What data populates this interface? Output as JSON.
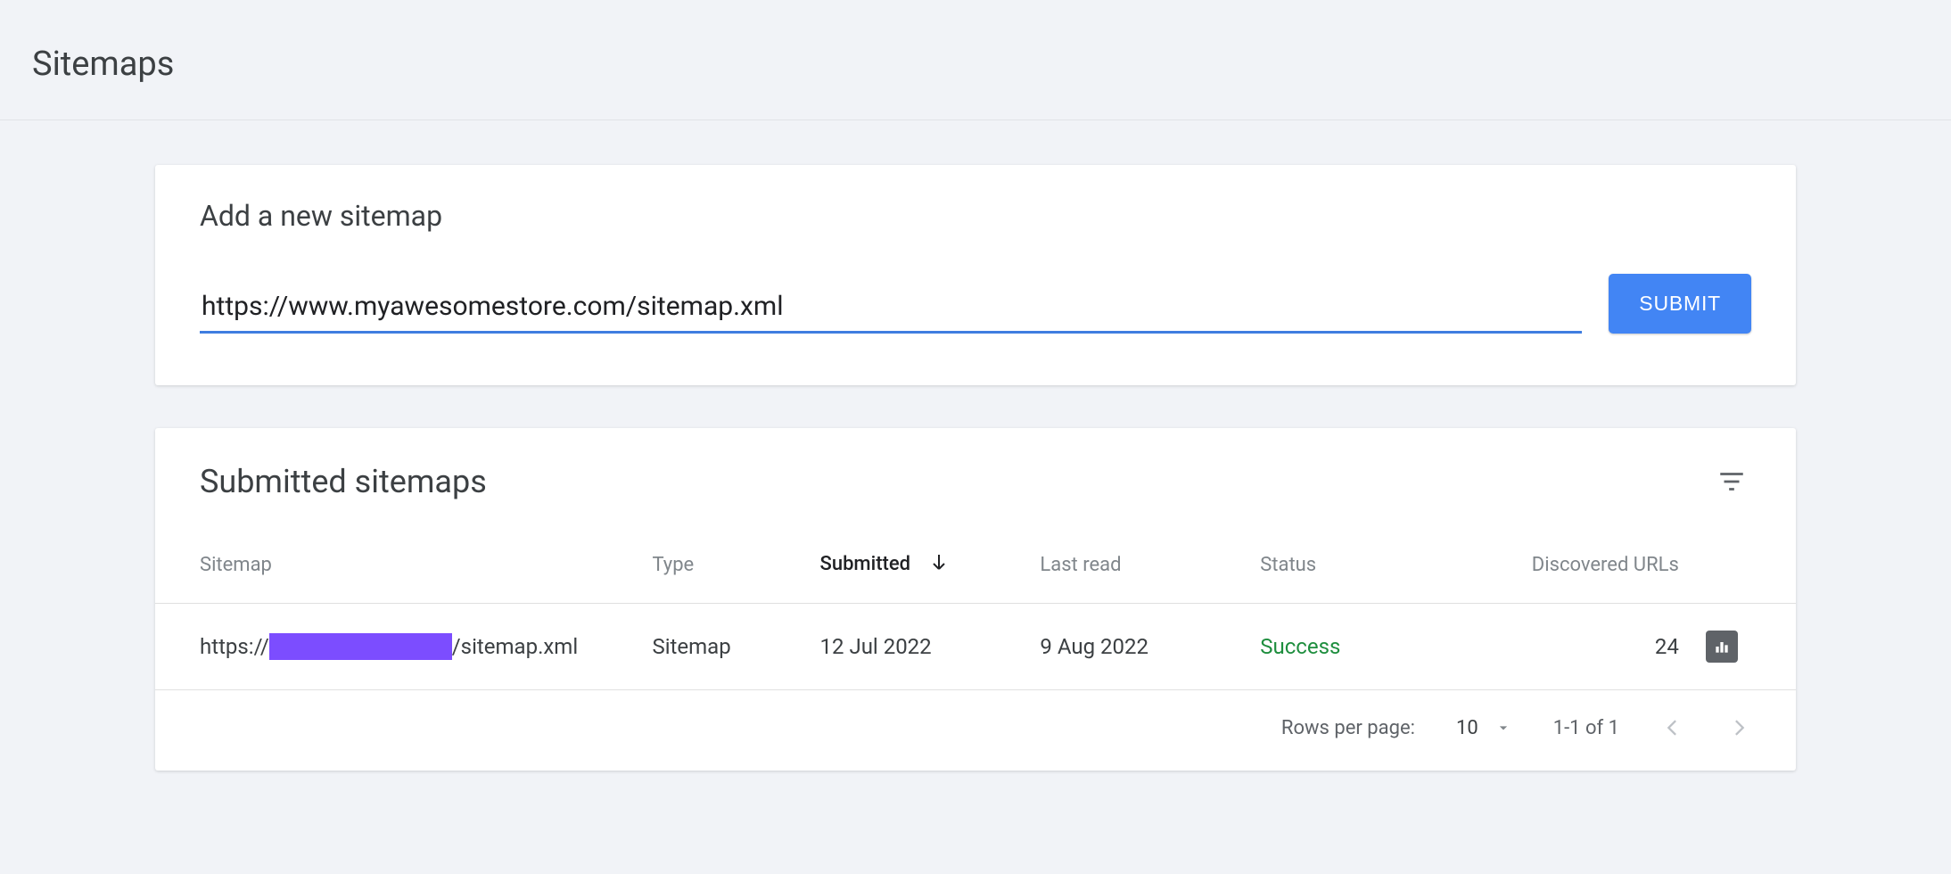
{
  "header": {
    "title": "Sitemaps"
  },
  "add": {
    "title": "Add a new sitemap",
    "input_value": "https://www.myawesomestore.com/sitemap.xml",
    "submit_label": "SUBMIT"
  },
  "list": {
    "title": "Submitted sitemaps",
    "columns": {
      "sitemap": "Sitemap",
      "type": "Type",
      "submitted": "Submitted",
      "last_read": "Last read",
      "status": "Status",
      "discovered": "Discovered URLs"
    },
    "rows": [
      {
        "url_prefix": "https://",
        "url_suffix": "/sitemap.xml",
        "type": "Sitemap",
        "submitted": "12 Jul 2022",
        "last_read": "9 Aug 2022",
        "status": "Success",
        "status_class": "success",
        "discovered": "24"
      }
    ],
    "pager": {
      "rows_label": "Rows per page:",
      "rows_value": "10",
      "range": "1-1 of 1"
    }
  }
}
